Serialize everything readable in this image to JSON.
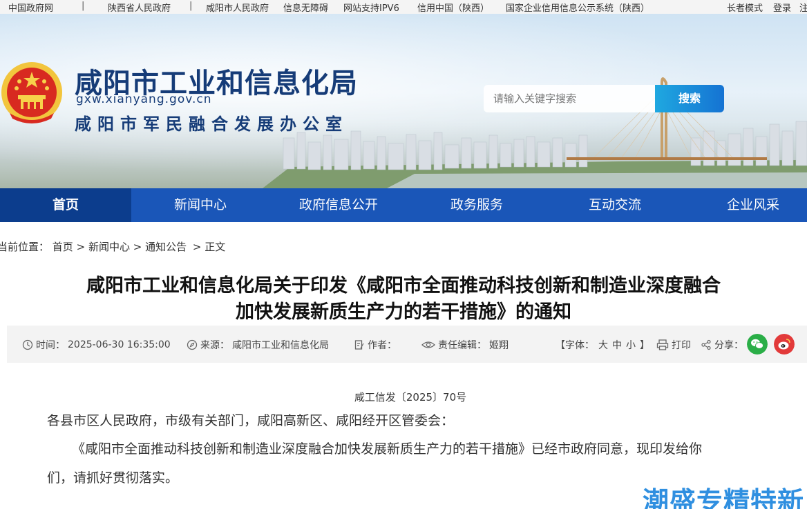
{
  "topbar": {
    "links": [
      "中国政府网",
      "陕西省人民政府",
      "咸阳市人民政府",
      "信息无障碍",
      "网站支持IPV6",
      "信用中国（陕西）",
      "国家企业信用信息公示系统（陕西）"
    ],
    "separator": "|",
    "elder_mode": "长者模式",
    "login": "登录",
    "register": "注"
  },
  "header": {
    "title": "咸阳市工业和信息化局",
    "url": "gxw.xianyang.gov.cn",
    "subtitle": "咸阳市军民融合发展办公室",
    "search_placeholder": "请输入关键字搜索",
    "search_button": "搜索"
  },
  "nav": {
    "items": [
      "首页",
      "新闻中心",
      "政府信息公开",
      "政务服务",
      "互动交流",
      "企业风采"
    ],
    "active_index": 0
  },
  "breadcrumb": {
    "label": "当前位置：",
    "items": [
      "首页",
      "新闻中心",
      "通知公告",
      "正文"
    ],
    "sep": ">"
  },
  "article": {
    "title_line1": "咸阳市工业和信息化局关于印发《咸阳市全面推动科技创新和制造业深度融合",
    "title_line2": "加快发展新质生产力的若干措施》的通知",
    "time_label": "时间：",
    "time": "2025-06-30 16:35:00",
    "source_label": "来源：",
    "source": "咸阳市工业和信息化局",
    "author_label": "作者：",
    "author": "",
    "editor_label": "责任编辑：",
    "editor": "姬翔",
    "font_label": "【字体：",
    "font_large": "大",
    "font_medium": "中",
    "font_small": "小",
    "font_close": "】",
    "print": "打印",
    "share": "分享：",
    "doc_number": "咸工信发〔2025〕70号",
    "greeting": "各县市区人民政府，市级有关部门，咸阳高新区、咸阳经开区管委会：",
    "body_line1": "《咸阳市全面推动科技创新和制造业深度融合加快发展新质生产力的若干措施》已经市政府同意，现印发给你",
    "body_line2": "们，请抓好贯彻落实。"
  },
  "watermark": "潮盛专精特新",
  "colors": {
    "nav_bg": "#1a56b8",
    "nav_active": "#0c3d8d",
    "title_blue": "#163c78",
    "wechat": "#2aae47",
    "weibo": "#e23a3a"
  }
}
